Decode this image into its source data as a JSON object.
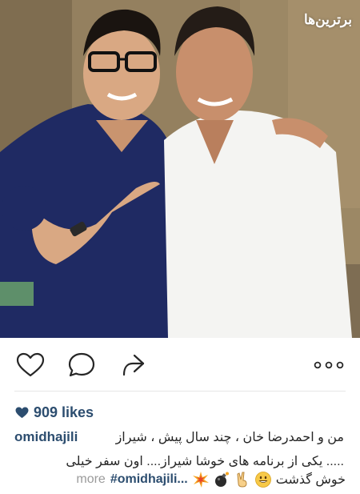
{
  "watermark": {
    "text": "برترین‌ها"
  },
  "actions": {
    "like_icon": "heart-outline-icon",
    "comment_icon": "comment-bubble-icon",
    "share_icon": "share-arrow-icon",
    "more_icon": "ellipsis-icon"
  },
  "likes": {
    "icon": "heart-filled-icon",
    "label": "909 likes"
  },
  "caption": {
    "username": "omidhajili",
    "line1": "من و احمدرضا خان ، چند سال پیش ، شیراز",
    "line2": "..... یکی از برنامه های خوشا شیراز.... اون سفر خیلی",
    "line3_text": "خوش گذشت",
    "hashtag": "#omidhajili...",
    "more": "more",
    "emojis": [
      "smiling-face-icon",
      "victory-hand-icon",
      "bomb-icon",
      "collision-icon"
    ]
  },
  "colors": {
    "link": "#2c4d6f",
    "text": "#262626",
    "muted": "#9b9b9b",
    "divider": "#e6e6e6"
  }
}
